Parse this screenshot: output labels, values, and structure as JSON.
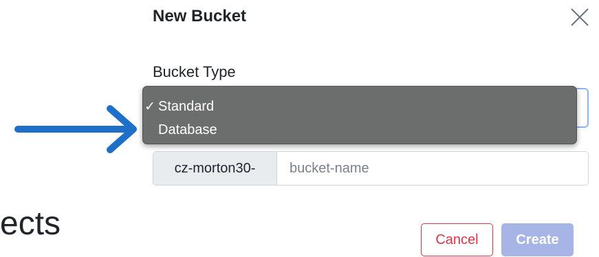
{
  "modal": {
    "title": "New Bucket",
    "close_icon": "close-icon"
  },
  "bucket_type": {
    "label": "Bucket Type",
    "selected": "Standard",
    "options": [
      {
        "label": "Standard",
        "checked": true,
        "check_mark": "✓"
      },
      {
        "label": "Database",
        "checked": false,
        "check_mark": ""
      }
    ]
  },
  "bucket_name": {
    "prefix": "cz-morton30-",
    "value": "",
    "placeholder": "bucket-name"
  },
  "background": {
    "partial_text": "ects"
  },
  "footer": {
    "cancel_label": "Cancel",
    "create_label": "Create"
  },
  "colors": {
    "arrow": "#1e6fc7",
    "cancel": "#dc3545",
    "create_disabled": "#a6b4e6",
    "dropdown_bg": "#6b6e6c"
  },
  "annotation": {
    "arrow_icon": "right-arrow-icon"
  }
}
